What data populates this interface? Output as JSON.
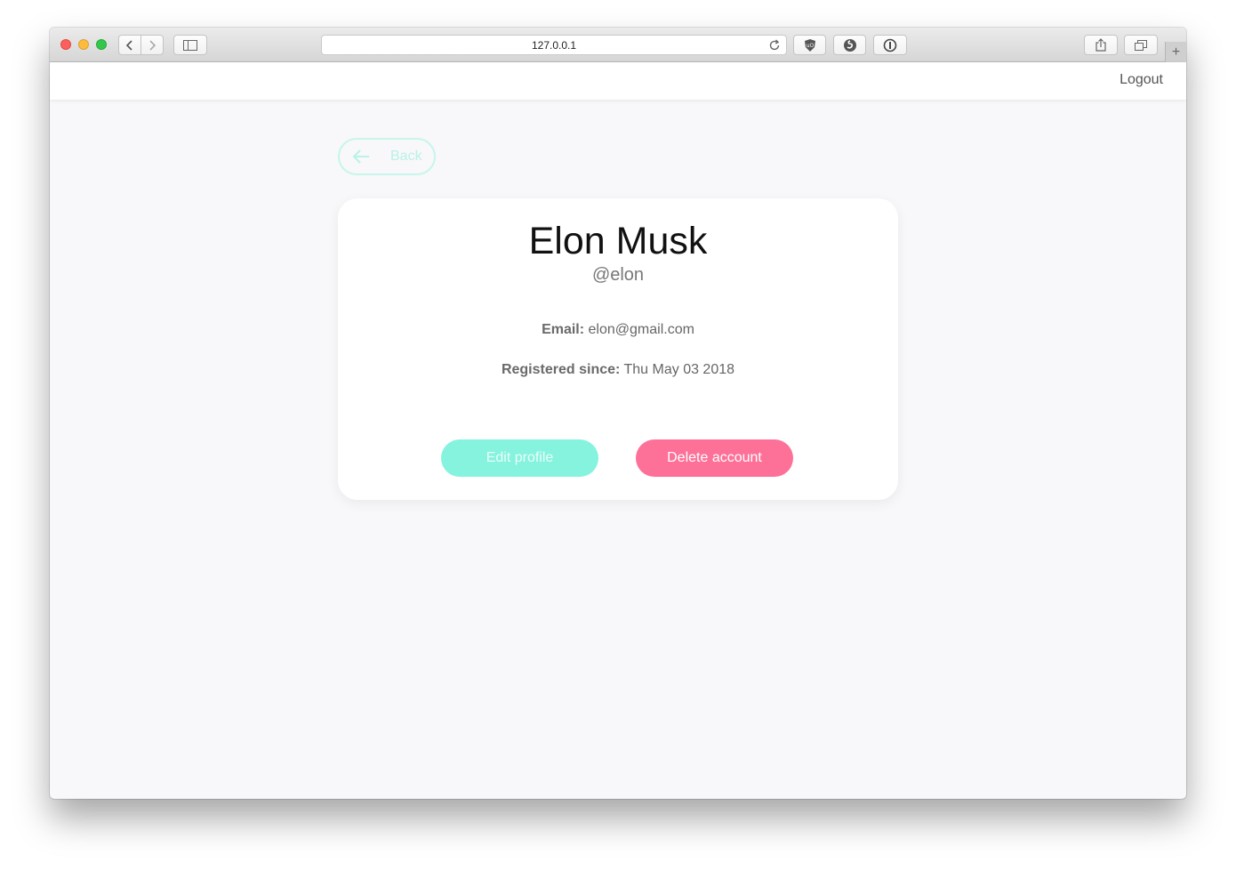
{
  "browser": {
    "url": "127.0.0.1",
    "new_tab_label": "+"
  },
  "nav": {
    "logout_label": "Logout"
  },
  "back": {
    "label": "Back"
  },
  "profile": {
    "name": "Elon Musk",
    "handle": "@elon",
    "email_label": "Email:",
    "email_value": "elon@gmail.com",
    "registered_label": "Registered since:",
    "registered_value": "Thu May 03 2018"
  },
  "actions": {
    "edit_label": "Edit profile",
    "delete_label": "Delete account"
  },
  "colors": {
    "accent_teal": "#86f3df",
    "danger_pink": "#fd7198",
    "page_bg": "#f8f7f9"
  },
  "icons": {
    "traffic": [
      "close-icon",
      "minimize-icon",
      "zoom-icon"
    ],
    "toolbar": [
      "chevron-left-icon",
      "chevron-right-icon",
      "sidebar-icon",
      "reload-icon",
      "ublock-icon",
      "extension-s-icon",
      "password-manager-icon",
      "share-icon",
      "tabs-icon"
    ],
    "back": "arrow-left-icon"
  }
}
